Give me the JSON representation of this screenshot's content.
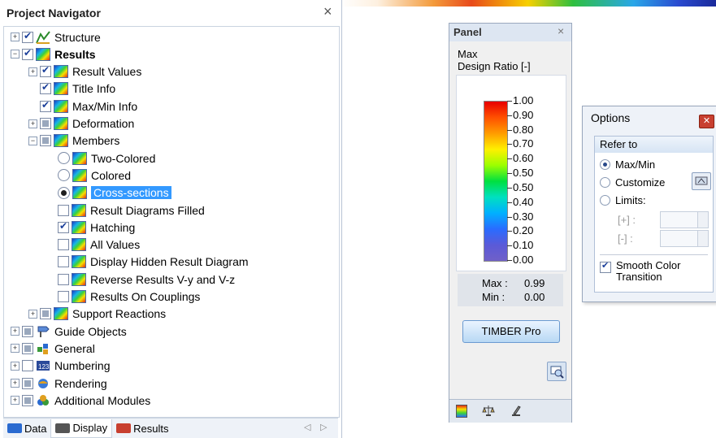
{
  "navigator": {
    "title": "Project Navigator",
    "close": "×",
    "tree": [
      {
        "label": "Structure",
        "level": 0,
        "expander": "+",
        "check": "checked",
        "icon": "structure-icon"
      },
      {
        "label": "Results",
        "level": 0,
        "expander": "-",
        "check": "checked",
        "icon": "results-icon",
        "bold": true
      },
      {
        "label": "Result Values",
        "level": 1,
        "expander": "+",
        "check": "checked",
        "icon": "results-icon"
      },
      {
        "label": "Title Info",
        "level": 1,
        "expander": "",
        "check": "checked",
        "icon": "results-icon"
      },
      {
        "label": "Max/Min Info",
        "level": 1,
        "expander": "",
        "check": "checked",
        "icon": "results-icon"
      },
      {
        "label": "Deformation",
        "level": 1,
        "expander": "+",
        "check": "partial",
        "icon": "results-icon"
      },
      {
        "label": "Members",
        "level": 1,
        "expander": "-",
        "check": "partial",
        "icon": "results-icon"
      },
      {
        "label": "Two-Colored",
        "level": 2,
        "expander": "",
        "radio": "off",
        "icon": "results-icon"
      },
      {
        "label": "Colored",
        "level": 2,
        "expander": "",
        "radio": "off",
        "icon": "results-icon"
      },
      {
        "label": "Cross-sections",
        "level": 2,
        "expander": "",
        "radio": "on",
        "icon": "results-icon",
        "selected": true
      },
      {
        "label": "Result Diagrams Filled",
        "level": 2,
        "expander": "",
        "check": "unchecked",
        "icon": "results-icon"
      },
      {
        "label": "Hatching",
        "level": 2,
        "expander": "",
        "check": "checked",
        "icon": "results-icon"
      },
      {
        "label": "All Values",
        "level": 2,
        "expander": "",
        "check": "unchecked",
        "icon": "results-icon"
      },
      {
        "label": "Display Hidden Result Diagram",
        "level": 2,
        "expander": "",
        "check": "unchecked",
        "icon": "results-icon"
      },
      {
        "label": "Reverse Results V-y and V-z",
        "level": 2,
        "expander": "",
        "check": "unchecked",
        "icon": "results-icon"
      },
      {
        "label": "Results On Couplings",
        "level": 2,
        "expander": "",
        "check": "unchecked",
        "icon": "results-icon"
      },
      {
        "label": "Support Reactions",
        "level": 1,
        "expander": "+",
        "check": "partial",
        "icon": "results-icon"
      },
      {
        "label": "Guide Objects",
        "level": 0,
        "expander": "+",
        "check": "partial",
        "icon": "guide-objects-icon"
      },
      {
        "label": "General",
        "level": 0,
        "expander": "+",
        "check": "partial",
        "icon": "general-icon"
      },
      {
        "label": "Numbering",
        "level": 0,
        "expander": "+",
        "check": "unchecked",
        "icon": "numbering-icon"
      },
      {
        "label": "Rendering",
        "level": 0,
        "expander": "+",
        "check": "partial",
        "icon": "rendering-icon"
      },
      {
        "label": "Additional Modules",
        "level": 0,
        "expander": "+",
        "check": "partial",
        "icon": "additional-modules-icon"
      }
    ],
    "tabs": [
      {
        "label": "Data",
        "icon": "data-tab-icon",
        "active": false
      },
      {
        "label": "Display",
        "icon": "display-tab-icon",
        "active": true
      },
      {
        "label": "Results",
        "icon": "results-tab-icon",
        "active": false
      }
    ],
    "scroll_left": "◁",
    "scroll_right": "▷"
  },
  "panel": {
    "title": "Panel",
    "close": "×",
    "heading_line1": "Max",
    "heading_line2": "Design Ratio [-]",
    "scale": [
      "1.00",
      "0.90",
      "0.80",
      "0.70",
      "0.60",
      "0.50",
      "0.50",
      "0.40",
      "0.30",
      "0.20",
      "0.10",
      "0.00"
    ],
    "max_label": "Max :",
    "max_value": "0.99",
    "min_label": "Min :",
    "min_value": "0.00",
    "button": "TIMBER Pro",
    "bottom_icons": [
      "color-scale-icon",
      "balance-icon",
      "filter-icon"
    ]
  },
  "options": {
    "title": "Options",
    "group": "Refer to",
    "radio_maxmin": "Max/Min",
    "radio_customize": "Customize",
    "radio_limits": "Limits:",
    "plus_label": "[+] :",
    "minus_label": "[-] :",
    "smooth_line1": "Smooth Color",
    "smooth_line2": "Transition",
    "selected": "Max/Min"
  }
}
